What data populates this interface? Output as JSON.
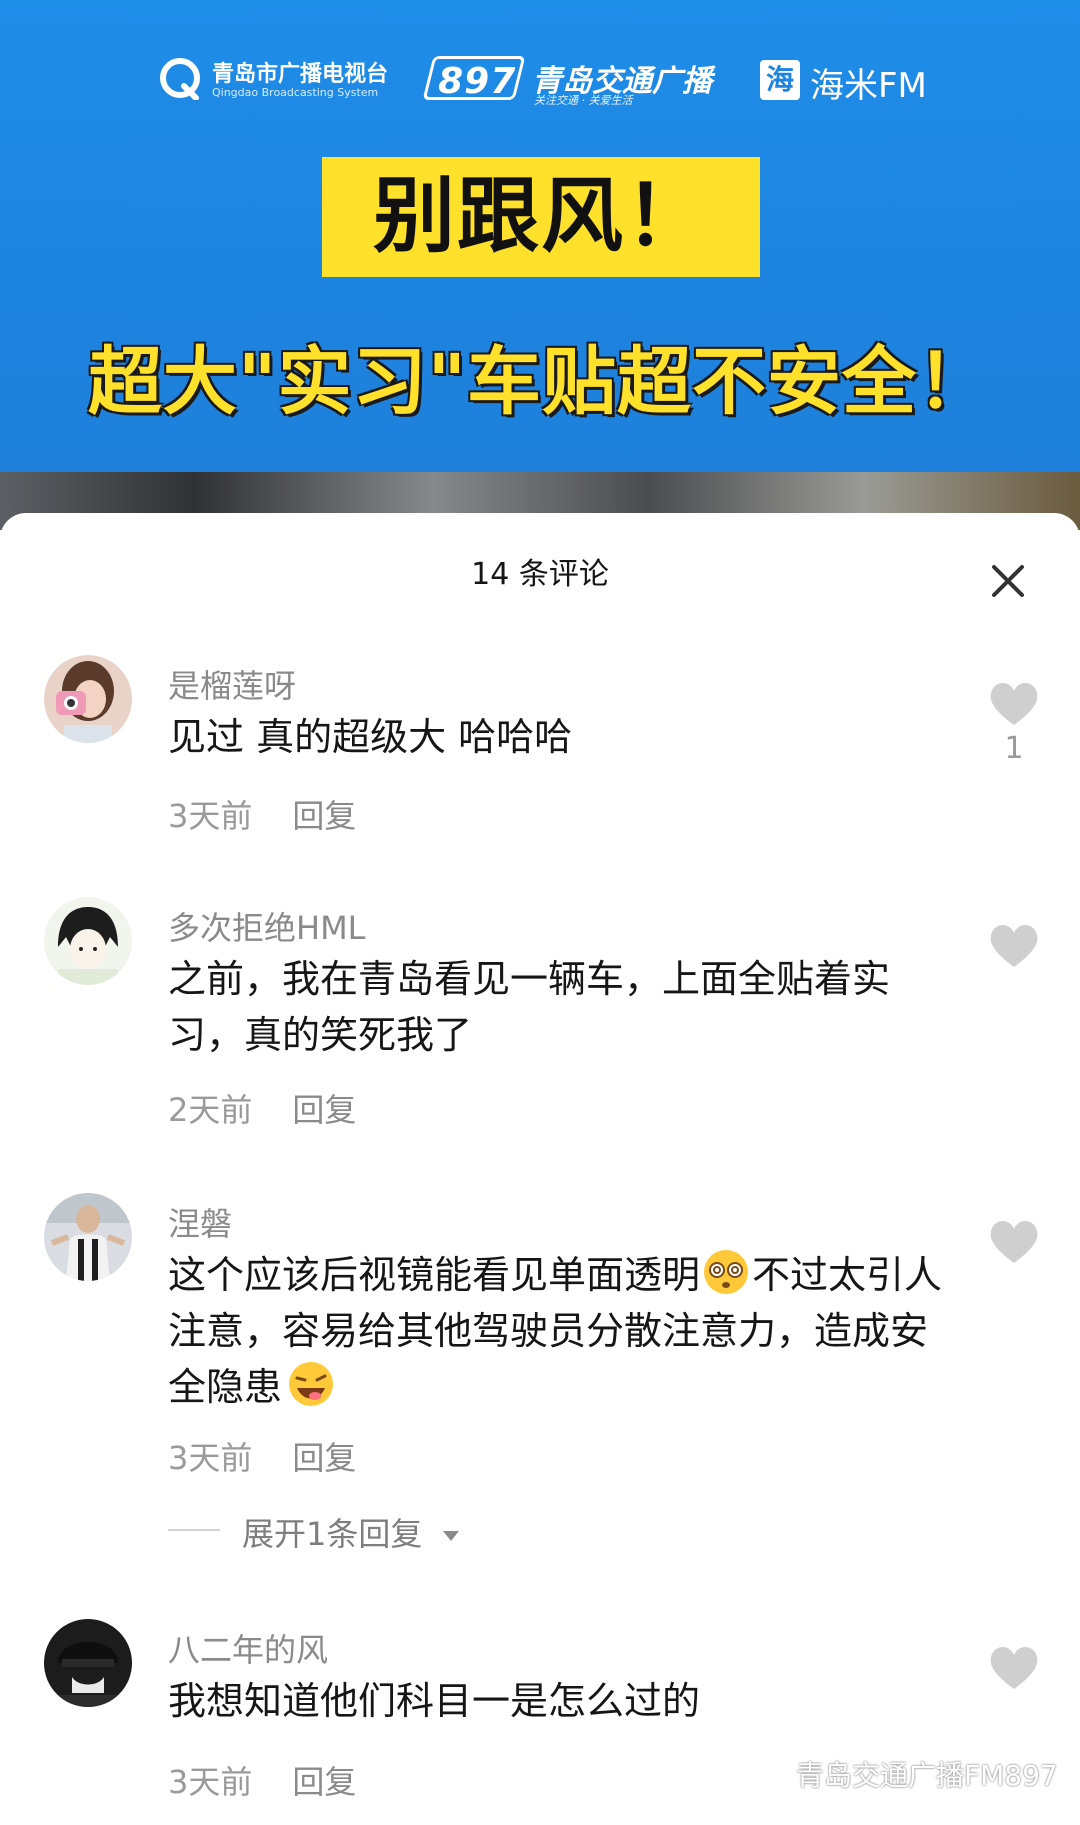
{
  "banner": {
    "logo_qd_name": "青岛市广播电视台",
    "logo_qd_en": "Qingdao Broadcasting System",
    "logo_897_number": "897",
    "logo_897_name": "青岛交通广播",
    "logo_897_sub": "关注交通 · 关爱生活",
    "logo_fm_box": "海",
    "logo_fm_name": "海米FM",
    "headline": "别跟风！",
    "subheadline": "超大\"实习\"车贴超不安全！"
  },
  "sheet": {
    "title": "14 条评论",
    "close_icon": "close-icon"
  },
  "comments": [
    {
      "user": "是榴莲呀",
      "text": "见过 真的超级大 哈哈哈",
      "time": "3天前",
      "reply": "回复",
      "likes": "1"
    },
    {
      "user": "多次拒绝HML",
      "text": "之前，我在青岛看见一辆车，上面全贴着实习，真的笑死我了",
      "time": "2天前",
      "reply": "回复",
      "likes": ""
    },
    {
      "user": "涅磐",
      "text_part1": "这个应该后视镜能看见单面透明",
      "text_part2": "不过太引人注意，容易给其他驾驶员分散注意力，造成安全隐患",
      "time": "3天前",
      "reply": "回复",
      "likes": "",
      "expand_label": "展开1条回复"
    },
    {
      "user": "八二年的风",
      "text": "我想知道他们科目一是怎么过的",
      "time": "3天前",
      "reply": "回复",
      "likes": ""
    }
  ],
  "watermark": "青岛交通广播FM897",
  "colors": {
    "banner_blue": "#1d84e0",
    "headline_yellow": "#ffe02b",
    "muted_text": "#8a8a8a",
    "heart_gray": "#cfcfcf"
  }
}
